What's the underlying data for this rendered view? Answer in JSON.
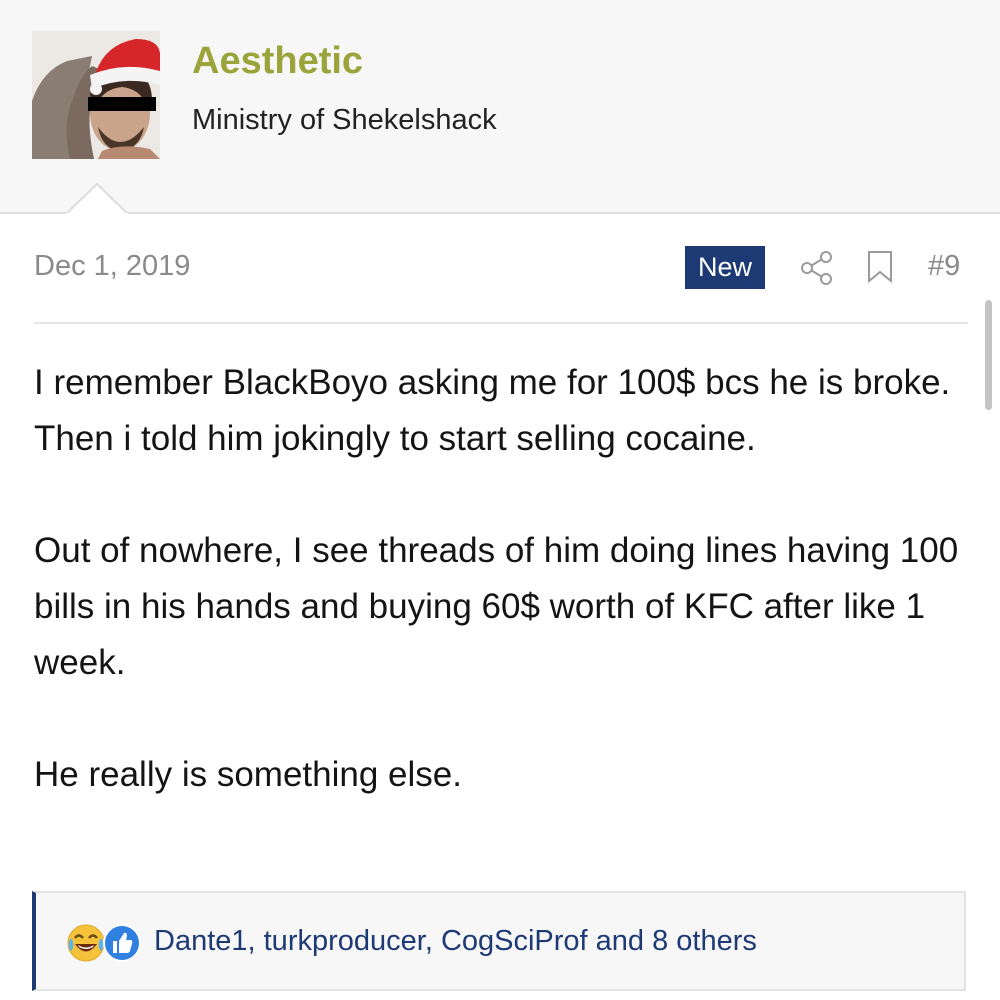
{
  "user": {
    "name": "Aesthetic",
    "title": "Ministry of Shekelshack"
  },
  "post": {
    "date": "Dec 1, 2019",
    "badge": "New",
    "number": "#9",
    "paragraphs": [
      "I remember BlackBoyo asking me for 100$ bcs he is broke. Then i told him jokingly to start selling cocaine.",
      "Out of nowhere, I see threads of him doing lines having 100 bills in his hands and buying 60$ worth of KFC after like 1 week.",
      "He really is something else."
    ]
  },
  "reactions": {
    "icons": [
      "laughing-emoji-icon",
      "thumbs-up-icon"
    ],
    "text": "Dante1, turkproducer, CogSciProf and 8 others"
  },
  "colors": {
    "username": "#9aa43a",
    "accent": "#1d3a75",
    "muted": "#8a8a8a"
  },
  "icons": {
    "share": "share-icon",
    "bookmark": "bookmark-icon"
  }
}
